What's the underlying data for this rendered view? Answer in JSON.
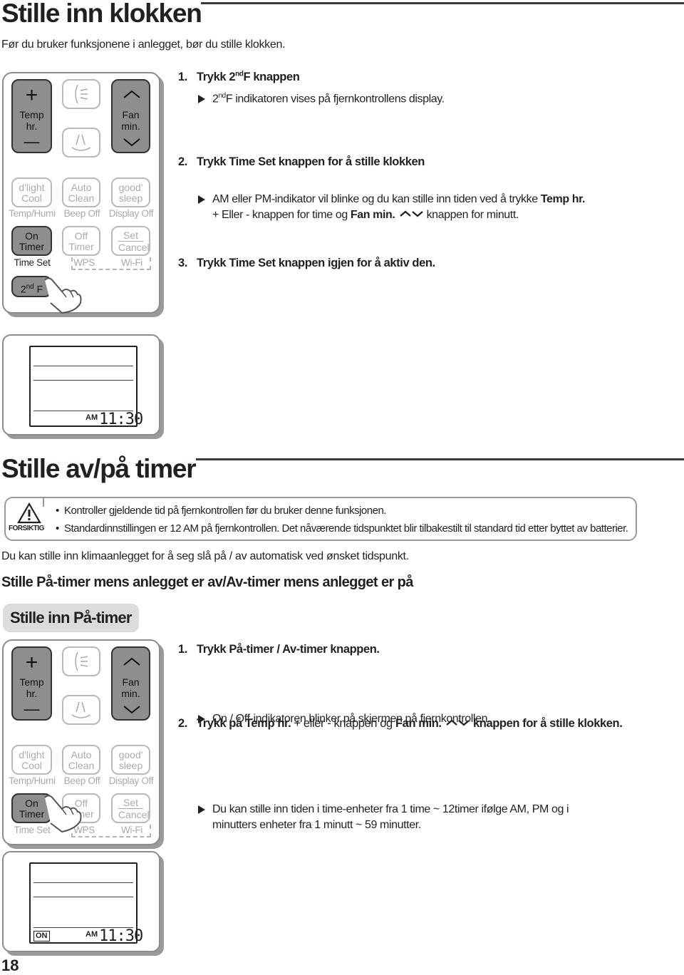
{
  "section1": {
    "title": "Stille inn klokken",
    "intro": "Før du bruker funksjonene i anlegget, bør du stille klokken.",
    "steps": [
      {
        "number": "1.",
        "text_pre": "Trykk ",
        "text_bold": "2",
        "text_sup": "nd",
        "text_bold2": "F knappen",
        "sub": "F indikatoren vises på fjernkontrollens display.",
        "sub_prefix": "2",
        "sub_sup": "nd"
      },
      {
        "number": "2.",
        "title": "Trykk Time Set knappen for å stille klokken",
        "sub_line1_pre": "AM eller PM-indikator vil blinke og du kan stille inn tiden ved å trykke ",
        "sub_line1_bold": "Temp hr.",
        "sub_line2_pre": "+ Eller - knappen for time og ",
        "sub_line2_bold": "Fan min.",
        "sub_line2_post": " knappen for minutt."
      },
      {
        "number": "3.",
        "text_pre": "Trykk ",
        "text_bold": "Time Set",
        "text_post": " knappen igjen for å aktiv den."
      }
    ]
  },
  "remote": {
    "temp": {
      "plus": "+",
      "label1": "Temp",
      "label2": "hr.",
      "minus": "—"
    },
    "fan": {
      "label1": "Fan",
      "label2": "min."
    },
    "dlight": {
      "line1": "d'light",
      "line2": "Cool",
      "caption": "Temp/Humi"
    },
    "auto_clean": {
      "line1": "Auto",
      "line2": "Clean",
      "caption": "Beep Off"
    },
    "good_sleep": {
      "line1": "good'",
      "line2": "sleep",
      "caption": "Display Off"
    },
    "on_timer": {
      "line1": "On",
      "line2": "Timer",
      "caption": "Time Set"
    },
    "off_timer": {
      "line1": "Off",
      "line2": "Timer",
      "caption": "WPS"
    },
    "set_cancel": {
      "line1": "Set",
      "line2": "Cancel",
      "caption": "Wi-Fi"
    },
    "second_f": {
      "label": "2",
      "sup": "nd",
      "label2": " F"
    }
  },
  "display1": {
    "am": "AM",
    "time": "11:30"
  },
  "section2": {
    "title": "Stille av/på timer",
    "caution_label": "FORSIKTIG",
    "caution_items": [
      "Kontroller gjeldende tid på fjernkontrollen før du bruker denne funksjonen.",
      "Standardinnstillingen er 12 AM på fjernkontrollen. Det nåværende tidspunktet blir tilbakestilt til standard tid etter byttet av batterier."
    ],
    "intro": "Du kan stille inn klimaanlegget for å seg slå på / av automatisk ved ønsket tidspunkt.",
    "subtitle": "Stille På-timer mens anlegget er av/Av-timer mens anlegget er på",
    "pill": "Stille inn På-timer",
    "steps": [
      {
        "number": "1.",
        "pre": "Trykk ",
        "bold": "På-timer / Av-timer",
        "post": " knappen.",
        "sub": "On / Off-indikatoren blinker på skjermen på fjernkontrollen."
      },
      {
        "number": "2.",
        "pre": "Trykk på ",
        "bold": "Temp hr.",
        "mid": " + eller - knappen og ",
        "bold2": "Fan min.",
        "post": " knappen for å stille klokken.",
        "sub_line1": "Du kan stille inn tiden i time-enheter fra 1 time ~ 12timer ifølge AM, PM og i",
        "sub_line2": "minutters enheter fra 1 minutt ~ 59 minutter."
      }
    ]
  },
  "display2": {
    "on": "ON",
    "am": "AM",
    "time": "11:30"
  },
  "page_number": "18"
}
